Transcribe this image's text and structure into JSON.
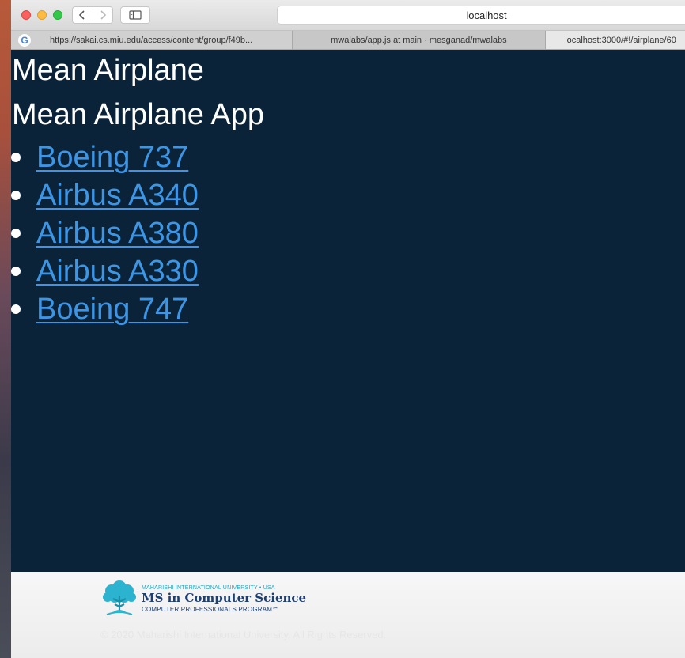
{
  "browser": {
    "url_display": "localhost",
    "tabs": [
      {
        "label": "https://sakai.cs.miu.edu/access/content/group/f49b...",
        "favicon": "google-icon",
        "active": false
      },
      {
        "label": "mwalabs/app.js at main · mesganad/mwalabs",
        "active": false
      },
      {
        "label": "localhost:3000/#!/airplane/60",
        "active": true
      }
    ]
  },
  "page": {
    "title": "Mean Airplane",
    "subtitle": "Mean Airplane App",
    "airplanes": [
      "Boeing 737",
      "Airbus A340",
      "Airbus A380",
      "Airbus A330",
      "Boeing 747"
    ]
  },
  "footer": {
    "logo_university": "MAHARISHI INTERNATIONAL UNIVERSITY • USA",
    "logo_program": "MS in Computer Science",
    "logo_subtitle": "COMPUTER PROFESSIONALS PROGRAM℠",
    "copyright": "© 2020 Maharishi International University. All Rights Reserved."
  },
  "colors": {
    "page_background": "#0a2338",
    "link": "#3d95e6",
    "footer_background": "#f2f2f2"
  }
}
